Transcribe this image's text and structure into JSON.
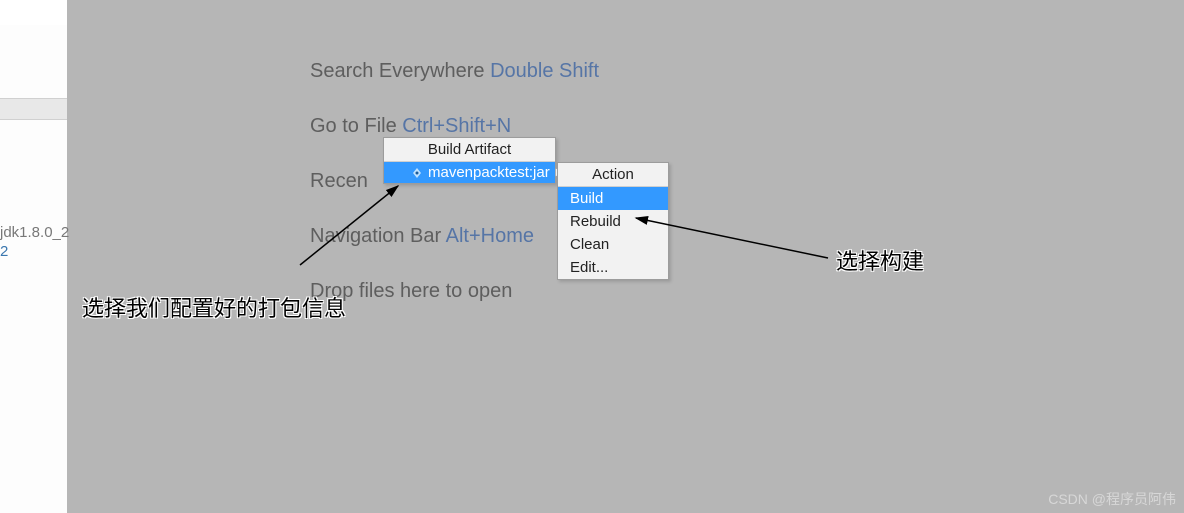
{
  "left": {
    "jdk": "jdk1.8.0_2",
    "num": "2"
  },
  "tips": {
    "search": {
      "label": "Search Everywhere ",
      "shortcut": "Double Shift"
    },
    "goto": {
      "label": "Go to File ",
      "shortcut": "Ctrl+Shift+N"
    },
    "recent": {
      "label": "Recen"
    },
    "navbar": {
      "label": "Navigation Bar ",
      "shortcut": "Alt+Home"
    },
    "drop": {
      "label": "Drop files here to open"
    }
  },
  "artifact_menu": {
    "title": "Build Artifact",
    "item": "mavenpacktest:jar"
  },
  "action_menu": {
    "title": "Action",
    "items": [
      "Build",
      "Rebuild",
      "Clean",
      "Edit..."
    ],
    "selected_index": 0
  },
  "annotations": {
    "left": "选择我们配置好的打包信息",
    "right": "选择构建"
  },
  "watermark": "CSDN @程序员阿伟"
}
